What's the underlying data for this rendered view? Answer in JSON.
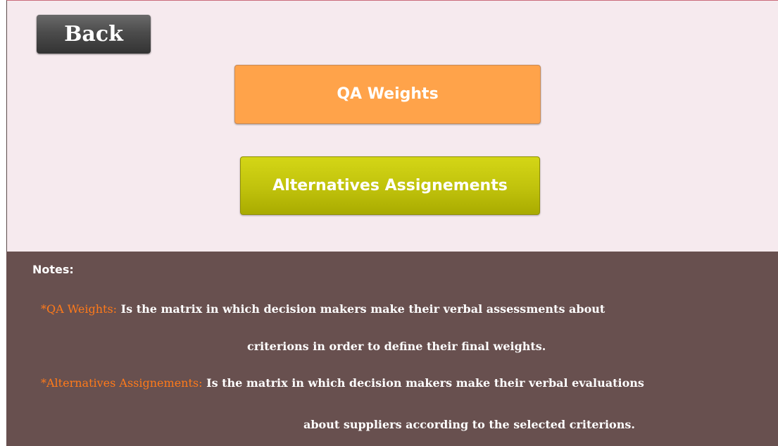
{
  "buttons": {
    "back_label": "Back",
    "qa_weights_label": "QA Weights",
    "alternatives_label": "Alternatives Assignements"
  },
  "notes": {
    "title": "Notes:",
    "qa_weights": {
      "key": "*QA Weights:",
      "line1": "Is the matrix in which decision makers make their verbal assessments about",
      "line2": "criterions in order to define their final weights."
    },
    "alternatives": {
      "key": "*Alternatives Assignements:",
      "line1": "Is the matrix in which decision makers make their verbal evaluations",
      "line2": "about suppliers according to the selected criterions."
    }
  },
  "colors": {
    "qa_button": "#ffa34a",
    "alternatives_button": "#c0c20c",
    "notes_background": "#68504f",
    "top_background": "#f6eaee",
    "note_key": "#ff7a1a"
  }
}
